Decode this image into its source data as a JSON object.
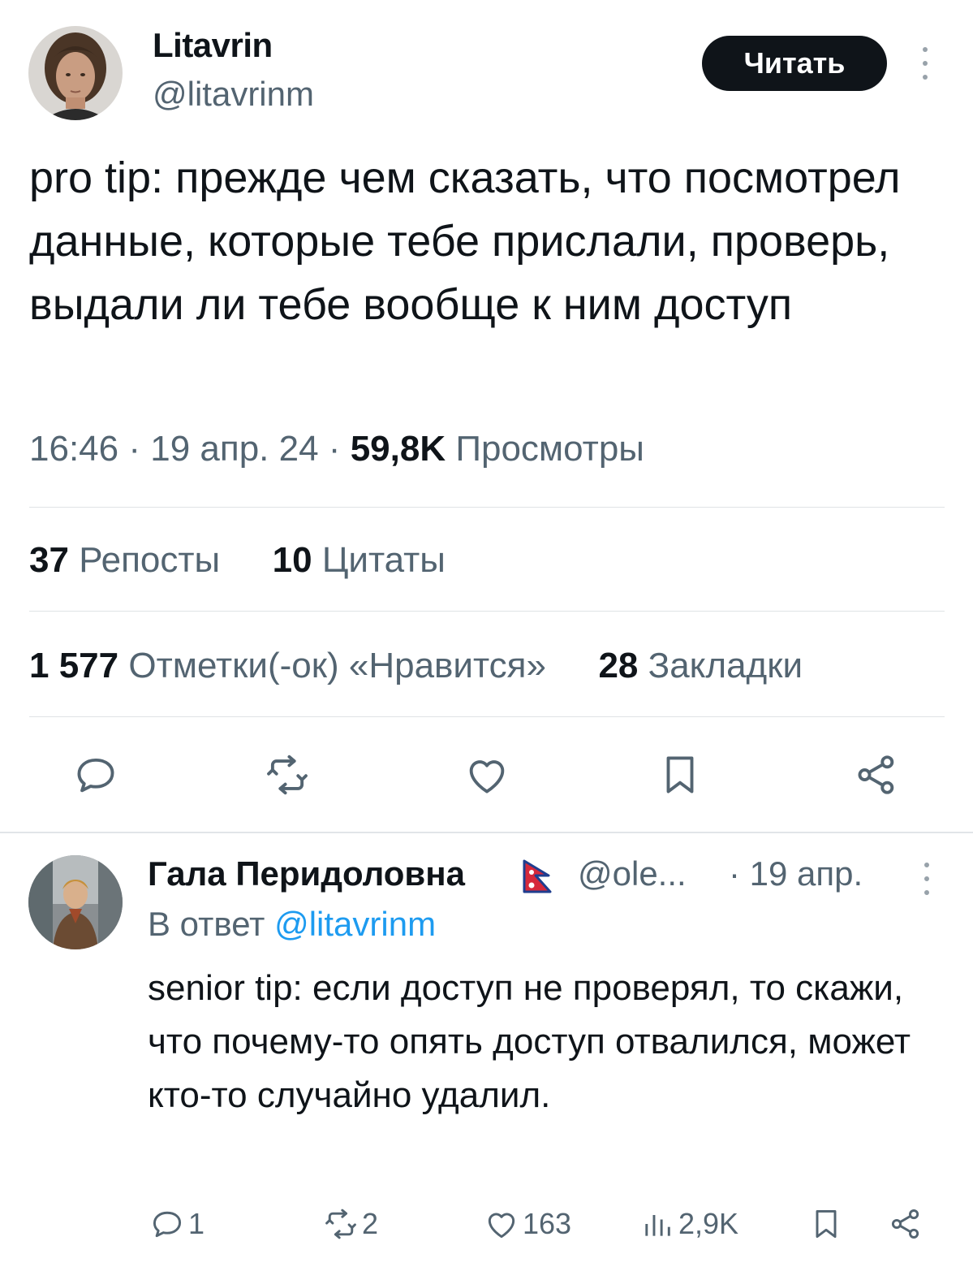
{
  "tweet": {
    "author_name": "Litavrin",
    "author_handle": "@litavrinm",
    "follow_label": "Читать",
    "text": "pro tip: прежде чем сказать, что посмотрел данные, которые тебе прислали, проверь, выдали ли тебе вообще к ним доступ",
    "time": "16:46",
    "date": "19 апр. 24",
    "views_count": "59,8K",
    "views_label": "Просмотры",
    "reposts_count": "37",
    "reposts_label": "Репосты",
    "quotes_count": "10",
    "quotes_label": "Цитаты",
    "likes_count": "1 577",
    "likes_label": "Отметки(-ок) «Нравится»",
    "bookmarks_count": "28",
    "bookmarks_label": "Закладки",
    "actions": [
      "reply-icon",
      "repost-icon",
      "like-icon",
      "bookmark-icon",
      "share-icon"
    ]
  },
  "reply": {
    "author_name": "Гала Перидоловна",
    "flag_icon": "nepal-flag-icon",
    "author_handle": "@ole...",
    "date": "· 19 апр.",
    "in_reply_prefix": "В ответ",
    "in_reply_handle": "@litavrinm",
    "text": "senior tip: если доступ не проверял, то скажи, что почему-то опять доступ отвалился, может кто-то случайно удалил.",
    "reply_count": "1",
    "repost_count": "2",
    "like_count": "163",
    "views_count": "2,9K"
  },
  "colors": {
    "text_primary": "#0f1419",
    "text_secondary": "#536471",
    "link": "#1d9bf0",
    "follow_button_bg": "#0f1419",
    "divider": "#dfe3e6"
  }
}
